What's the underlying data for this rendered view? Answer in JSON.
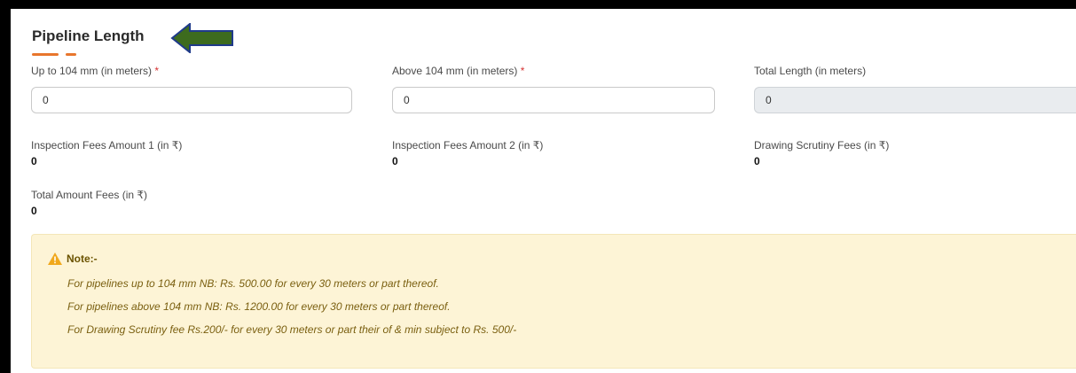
{
  "section": {
    "title": "Pipeline Length"
  },
  "fields": {
    "up_to_104": {
      "label": "Up to 104 mm (in meters)",
      "required_mark": "*",
      "value": "0"
    },
    "above_104": {
      "label": "Above 104 mm (in meters)",
      "required_mark": "*",
      "value": "0"
    },
    "total_length": {
      "label": "Total Length (in meters)",
      "value": "0"
    }
  },
  "fees": {
    "inspection_1": {
      "label": "Inspection Fees Amount 1 (in ₹)",
      "value": "0"
    },
    "inspection_2": {
      "label": "Inspection Fees Amount 2 (in ₹)",
      "value": "0"
    },
    "drawing_scrutiny": {
      "label": "Drawing Scrutiny Fees (in ₹)",
      "value": "0"
    },
    "total_amount": {
      "label": "Total Amount Fees (in ₹)",
      "value": "0"
    }
  },
  "note": {
    "title": "Note:-",
    "lines": [
      "For pipelines up to 104 mm NB: Rs. 500.00 for every 30 meters or part thereof.",
      "For pipelines above 104 mm NB: Rs. 1200.00 for every 30 meters or part thereof.",
      "For Drawing Scrutiny fee Rs.200/- for every 30 meters or part their of & min subject to Rs. 500/-"
    ],
    "icon": "warning-icon"
  },
  "annotation": {
    "icon": "arrow-left-icon",
    "color": "#3d6b1e"
  },
  "colors": {
    "accent": "#e8762d",
    "required": "#d63333",
    "note_bg": "#fdf4d6"
  }
}
